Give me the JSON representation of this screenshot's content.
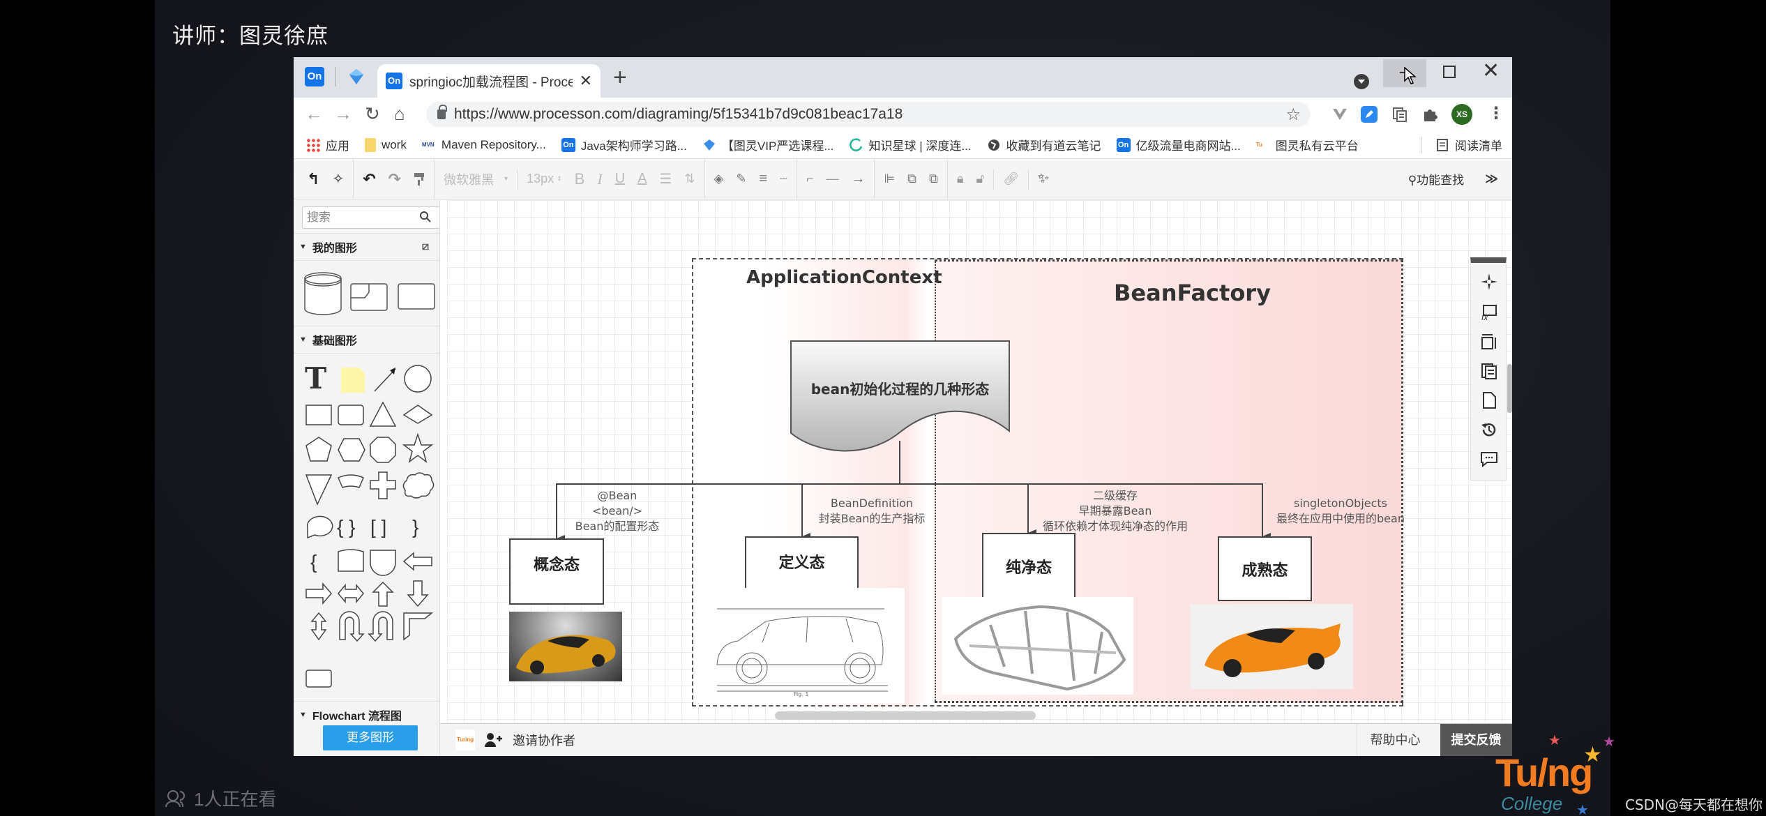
{
  "overlay": {
    "lecturer": "讲师：图灵徐庶",
    "viewers": "1人正在看",
    "watermark": "CSDN@每天都在想你",
    "logo_main": "Tu/ng",
    "logo_sub": "College"
  },
  "browser": {
    "tabs": [
      {
        "label": "On",
        "pinned": true
      },
      {
        "label": "",
        "pinned": true,
        "icon": "diamond-app-icon"
      },
      {
        "label": "springioc加载流程图 - ProcessOn",
        "active": true,
        "icon_text": "On"
      }
    ],
    "new_tab": "+",
    "url": "https://www.processon.com/diagraming/5f15341b7d9c081beac17a18",
    "avatar_initials": "XS",
    "bookmarks": [
      {
        "label": "应用",
        "icon": "apps-grid-icon"
      },
      {
        "label": "work",
        "icon": "folder-icon"
      },
      {
        "label": "Maven Repository...",
        "icon": "mvn-icon"
      },
      {
        "label": "Java架构师学习路...",
        "icon": "on-icon"
      },
      {
        "label": "【图灵VIP严选课程...",
        "icon": "diamond-icon"
      },
      {
        "label": "知识星球 | 深度连...",
        "icon": "ring-icon"
      },
      {
        "label": "收藏到有道云笔记",
        "icon": "globe-icon"
      },
      {
        "label": "亿级流量电商网站...",
        "icon": "on-icon"
      },
      {
        "label": "图灵私有云平台",
        "icon": "turing-icon"
      }
    ],
    "reading_list": "阅读清单"
  },
  "toolbar": {
    "font_family": "微软雅黑",
    "font_size": "13px",
    "bold": "B",
    "italic": "I",
    "underline": "U",
    "font_color": "A",
    "function_search": "功能查找"
  },
  "sidebar": {
    "search_placeholder": "搜索",
    "sections": [
      {
        "title": "我的图形"
      },
      {
        "title": "基础图形"
      },
      {
        "title": "Flowchart 流程图"
      }
    ],
    "more_shapes": "更多图形"
  },
  "bottom": {
    "invite": "邀请协作者",
    "help": "帮助中心",
    "feedback": "提交反馈"
  },
  "diagram": {
    "container_left": "ApplicationContext",
    "container_right": "BeanFactory",
    "root": "bean初始化过程的几种形态",
    "states": [
      {
        "name": "概念态",
        "label_lines": [
          "@Bean",
          "<bean/>",
          "Bean的配置形态"
        ],
        "image": "sports-car-photo"
      },
      {
        "name": "定义态",
        "label_lines": [
          "BeanDefinition",
          "封装Bean的生产指标"
        ],
        "image": "car-blueprint-drawing"
      },
      {
        "name": "纯净态",
        "label_lines": [
          "二级缓存",
          "早期暴露Bean",
          "循环依赖才体现纯净态的作用"
        ],
        "image": "car-chassis-frame"
      },
      {
        "name": "成熟态",
        "label_lines": [
          "singletonObjects",
          "最终在应用中使用的bean"
        ],
        "image": "finished-sports-car-photo"
      }
    ],
    "blueprint_caption": "Fig. 1"
  },
  "colors": {
    "accent_blue": "#2a9ee8",
    "processon_blue": "#1473e6",
    "beanfactory_pink": "#fde0e0",
    "avatar_green": "#2e6b22",
    "turing_orange": "#f47c20"
  }
}
